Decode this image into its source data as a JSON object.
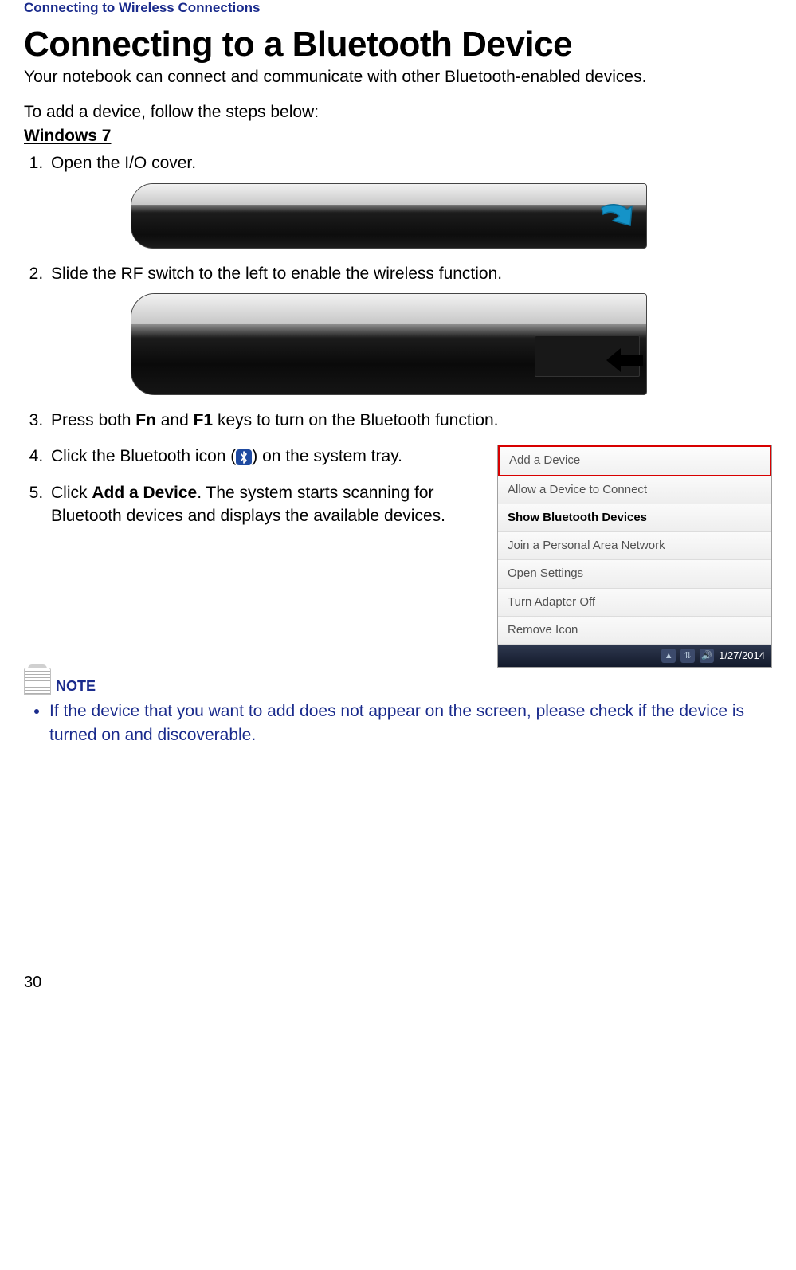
{
  "header": {
    "title": "Connecting to Wireless Connections"
  },
  "main": {
    "title": "Connecting to a Bluetooth Device",
    "intro": "Your notebook can connect and communicate with other Bluetooth-enabled devices.",
    "leadin": "To add a device, follow the steps below:",
    "os_label": "Windows 7",
    "steps": {
      "s1": "Open the I/O cover.",
      "s2": "Slide the RF switch to the left to enable the wireless function.",
      "s3_pre": "Press both ",
      "s3_k1": "Fn",
      "s3_mid": " and ",
      "s3_k2": "F1",
      "s3_post": " keys to turn on the Bluetooth function.",
      "s4_pre": "Click the Bluetooth icon (",
      "s4_post": ") on the system tray.",
      "s5_pre": "Click ",
      "s5_bold": "Add a Device",
      "s5_post": ". The system starts scanning for Bluetooth devices and displays the available devices."
    }
  },
  "menu": {
    "items": [
      "Add a Device",
      "Allow a Device to Connect",
      "Show Bluetooth Devices",
      "Join a Personal Area Network",
      "Open Settings",
      "Turn Adapter Off",
      "Remove Icon"
    ],
    "taskbar_date": "1/27/2014"
  },
  "note": {
    "label": "NOTE",
    "text": "If the device that you want to add does not appear on the screen, please check if the device is turned on and discoverable."
  },
  "footer": {
    "page": "30"
  },
  "icons": {
    "bt_glyph": "⁎"
  }
}
